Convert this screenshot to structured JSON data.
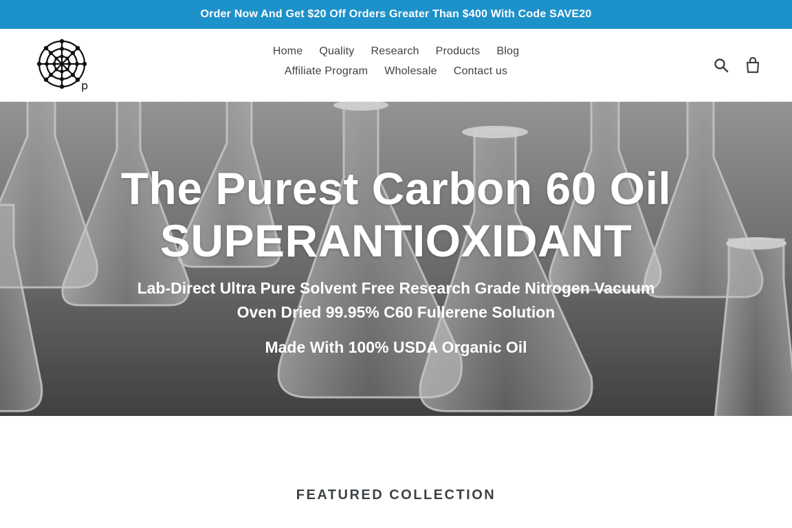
{
  "announcement": {
    "text": "Order Now And Get $20 Off Orders Greater Than $400 With Code SAVE20"
  },
  "brand": {
    "logo_icon": "fullerene-molecule-icon",
    "logo_letter": "p",
    "accent_color": "#1d91c9"
  },
  "nav": {
    "row1": [
      {
        "label": "Home"
      },
      {
        "label": "Quality"
      },
      {
        "label": "Research"
      },
      {
        "label": "Products"
      },
      {
        "label": "Blog"
      }
    ],
    "row2": [
      {
        "label": "Affiliate Program"
      },
      {
        "label": "Wholesale"
      },
      {
        "label": "Contact us"
      }
    ]
  },
  "header_icons": {
    "search": "search-icon",
    "cart": "cart-icon"
  },
  "hero": {
    "title_line1": "The Purest Carbon 60 Oil",
    "title_line2": "SUPERANTIOXIDANT",
    "subtitle": "Lab-Direct Ultra Pure Solvent Free Research Grade Nitrogen Vacuum Oven Dried 99.95% C60 Fullerene Solution",
    "subtitle2": "Made With 100% USDA Organic Oil"
  },
  "featured": {
    "heading": "FEATURED COLLECTION"
  }
}
